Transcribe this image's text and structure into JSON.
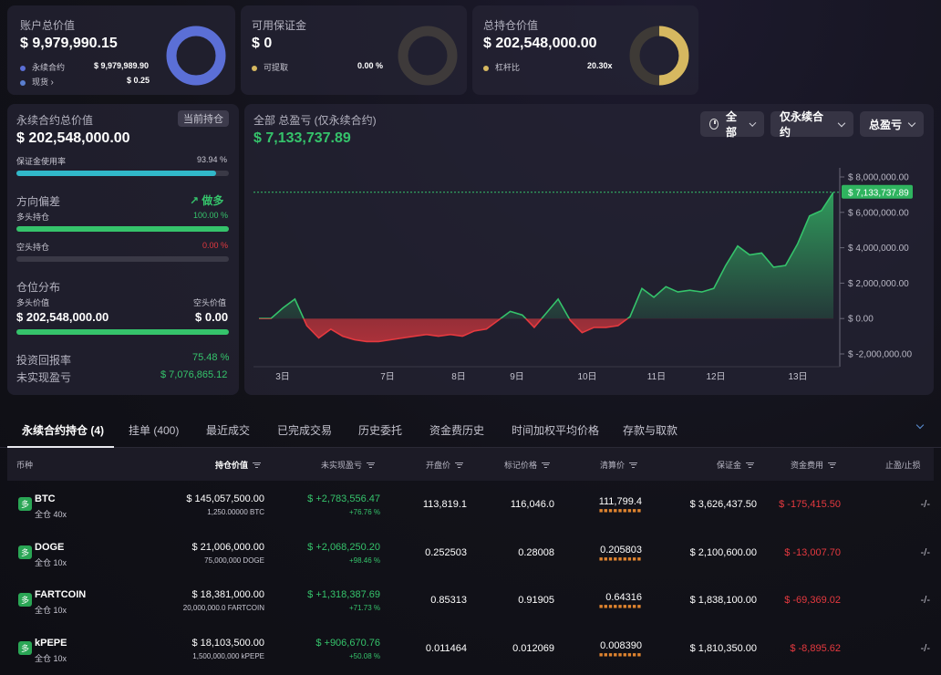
{
  "summary": {
    "account_total": {
      "label": "账户总价值",
      "value": "$ 9,979,990.15",
      "perp_label": "永续合约",
      "perp_value": "$ 9,979,989.90",
      "spot_label": "现货",
      "spot_value": "$ 0.25"
    },
    "available_margin": {
      "label": "可用保证金",
      "value": "$ 0",
      "withdraw_label": "可提取",
      "withdraw_value": "0.00 %"
    },
    "total_position": {
      "label": "总持仓价值",
      "value": "$ 202,548,000.00",
      "leverage_label": "杠杆比",
      "leverage_value": "20.30x"
    }
  },
  "perp_panel": {
    "title": "永续合约总价值",
    "current_tag": "当前持仓",
    "value": "$ 202,548,000.00",
    "margin_usage_label": "保证金使用率",
    "margin_usage_value": "93.94 %",
    "margin_usage": 0.9394,
    "bias_label": "方向偏差",
    "bias_value": "做多",
    "long_label": "多头持仓",
    "long_value": "100.00 %",
    "long_fraction": 1.0,
    "short_label": "空头持仓",
    "short_value": "0.00 %",
    "short_fraction": 0.0,
    "dist_label": "仓位分布",
    "long_val_label": "多头价值",
    "short_val_label": "空头价值",
    "long_val": "$ 202,548,000.00",
    "short_val": "$ 0.00",
    "roi_label": "投资回报率",
    "roi_value": "75.48 %",
    "unrealized_label": "未实现盈亏",
    "unrealized_value": "$ 7,076,865.12"
  },
  "pnl_panel": {
    "title": "全部 总盈亏 (仅永续合约)",
    "value": "$ 7,133,737.89",
    "filter_all": "全部",
    "filter_perp": "仅永续合约",
    "filter_pnl": "总盈亏",
    "current_marker": "$ 7,133,737.89"
  },
  "chart_data": {
    "type": "area",
    "x_ticks": [
      "3日",
      "7日",
      "8日",
      "9日",
      "10日",
      "11日",
      "12日",
      "13日"
    ],
    "y_ticks": [
      "$ 8,000,000.00",
      "$ 6,000,000.00",
      "$ 4,000,000.00",
      "$ 2,000,000.00",
      "$ 0.00",
      "$ -2,000,000.00"
    ],
    "ylim": [
      -2000000,
      8000000
    ],
    "series": [
      {
        "values": [
          0,
          0,
          600000,
          1100000,
          -400000,
          -1100000,
          -600000,
          -1000000,
          -1200000,
          -1300000,
          -1300000,
          -1200000,
          -1100000,
          -1000000,
          -900000,
          -1000000,
          -900000,
          -1000000,
          -700000,
          -600000,
          -100000,
          400000,
          200000,
          -500000,
          300000,
          1100000,
          -100000,
          -800000,
          -500000,
          -500000,
          -400000,
          100000,
          1700000,
          1200000,
          1800000,
          1500000,
          1600000,
          1500000,
          1700000,
          3000000,
          4100000,
          3600000,
          3700000,
          2900000,
          3000000,
          4200000,
          5800000,
          6100000,
          7133737.89
        ]
      }
    ]
  },
  "tabs": [
    "永续合约持仓 (4)",
    "挂单 (400)",
    "最近成交",
    "已完成交易",
    "历史委托",
    "资金费历史",
    "时间加权平均价格",
    "存款与取款"
  ],
  "columns": [
    "币种",
    "持仓价值",
    "未实现盈亏",
    "开盘价",
    "标记价格",
    "清算价",
    "保证金",
    "资金费用",
    "止盈/止损"
  ],
  "rows": [
    {
      "coin": "BTC",
      "mode": "全仓 40x",
      "value": "$ 145,057,500.00",
      "size": "1,250.00000 BTC",
      "upnl": "$ +2,783,556.47",
      "upnl_pct": "+76.76 %",
      "entry": "113,819.1",
      "mark": "116,046.0",
      "liq": "111,799.4",
      "margin": "$ 3,626,437.50",
      "funding": "$ -175,415.50",
      "tpsl": "-/-",
      "badge": "多"
    },
    {
      "coin": "DOGE",
      "mode": "全仓 10x",
      "value": "$ 21,006,000.00",
      "size": "75,000,000 DOGE",
      "upnl": "$ +2,068,250.20",
      "upnl_pct": "+98.46 %",
      "entry": "0.252503",
      "mark": "0.28008",
      "liq": "0.205803",
      "margin": "$ 2,100,600.00",
      "funding": "$ -13,007.70",
      "tpsl": "-/-",
      "badge": "多"
    },
    {
      "coin": "FARTCOIN",
      "mode": "全仓 10x",
      "value": "$ 18,381,000.00",
      "size": "20,000,000.0 FARTCOIN",
      "upnl": "$ +1,318,387.69",
      "upnl_pct": "+71.73 %",
      "entry": "0.85313",
      "mark": "0.91905",
      "liq": "0.64316",
      "margin": "$ 1,838,100.00",
      "funding": "$ -69,369.02",
      "tpsl": "-/-",
      "badge": "多"
    },
    {
      "coin": "kPEPE",
      "mode": "全仓 10x",
      "value": "$ 18,103,500.00",
      "size": "1,500,000,000 kPEPE",
      "upnl": "$ +906,670.76",
      "upnl_pct": "+50.08 %",
      "entry": "0.011464",
      "mark": "0.012069",
      "liq": "0.008390",
      "margin": "$ 1,810,350.00",
      "funding": "$ -8,895.62",
      "tpsl": "-/-",
      "badge": "多"
    }
  ],
  "colors": {
    "accent_blue": "#5b6fd6",
    "gold": "#d6b860",
    "green": "#35c36b",
    "red": "#e5393f",
    "cyan": "#31b8c9"
  },
  "icons": {
    "clock": "clock-icon",
    "chevron": "chevron-down-icon",
    "trend": "trend-up-icon",
    "filter": "filter-icon",
    "info": "chevron-right-icon"
  }
}
